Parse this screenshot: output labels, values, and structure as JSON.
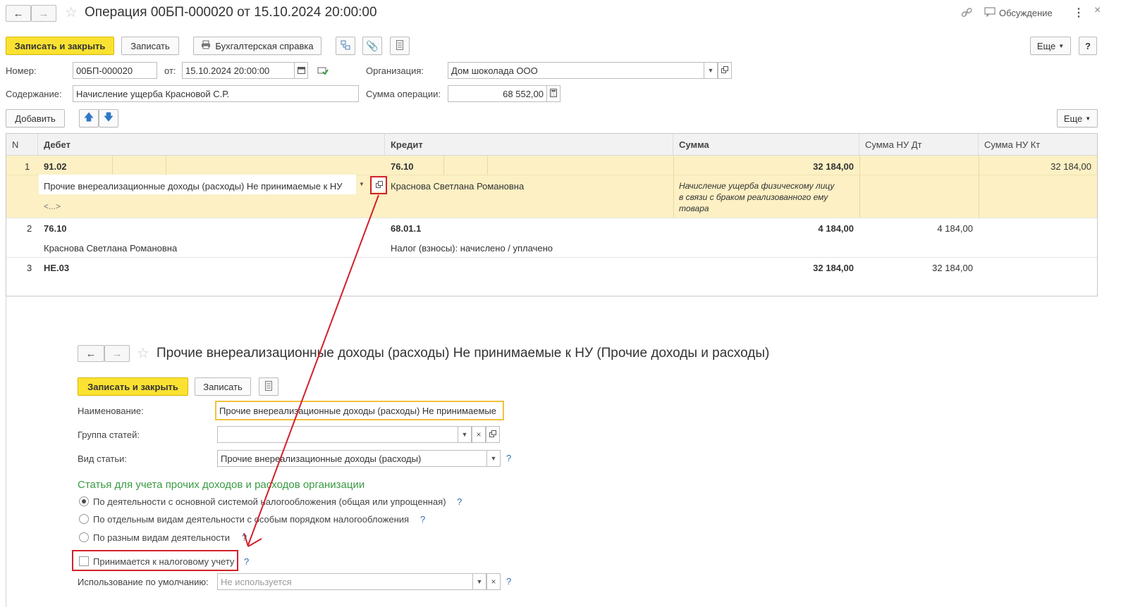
{
  "window": {
    "title": "Операция 00БП-000020 от 15.10.2024 20:00:00",
    "discussion_label": "Обсуждение",
    "more_menu_icon": "vertical-dots-icon"
  },
  "toolbar": {
    "save_close_label": "Записать и закрыть",
    "save_label": "Записать",
    "accounting_note_label": "Бухгалтерская справка",
    "more_label": "Еще",
    "help_label": "?"
  },
  "header": {
    "number_label": "Номер:",
    "number_value": "00БП-000020",
    "date_label": "от:",
    "date_value": "15.10.2024 20:00:00",
    "org_label": "Организация:",
    "org_value": "Дом шоколада ООО",
    "content_label": "Содержание:",
    "content_value": "Начисление ущерба Красновой С.Р.",
    "sum_label": "Сумма операции:",
    "sum_value": "68 552,00"
  },
  "table_toolbar": {
    "add_label": "Добавить",
    "more_label": "Еще"
  },
  "table": {
    "columns": [
      "N",
      "Дебет",
      "Кредит",
      "Сумма",
      "Сумма НУ Дт",
      "Сумма НУ Кт"
    ],
    "rows": [
      {
        "n": "1",
        "debit": "91.02",
        "debit_sub1": "Прочие внереализационные доходы (расходы) Не принимаемые к НУ",
        "debit_sub2": "<...>",
        "credit": "76.10",
        "credit_sub1": "Краснова Светлана Романовна",
        "sum": "32 184,00",
        "sum_comment_1": "Начисление ущерба физическому лицу",
        "sum_comment_2": "в связи с браком реализованного ему",
        "sum_comment_3": "товара",
        "nu_dt": "",
        "nu_kt": "32 184,00"
      },
      {
        "n": "2",
        "debit": "76.10",
        "debit_sub1": "Краснова Светлана Романовна",
        "credit": "68.01.1",
        "credit_sub1": "Налог (взносы): начислено / уплачено",
        "sum": "4 184,00",
        "nu_dt": "4 184,00",
        "nu_kt": ""
      },
      {
        "n": "3",
        "debit": "НЕ.03",
        "credit": "",
        "sum": "32 184,00",
        "nu_dt": "32 184,00",
        "nu_kt": ""
      }
    ]
  },
  "sub_form": {
    "title": "Прочие внереализационные доходы (расходы) Не принимаемые к НУ (Прочие доходы и расходы)",
    "save_close_label": "Записать и закрыть",
    "save_label": "Записать",
    "name_label": "Наименование:",
    "name_value": "Прочие внереализационные доходы (расходы) Не принимаемые",
    "group_label": "Группа статей:",
    "group_value": "",
    "kind_label": "Вид статьи:",
    "kind_value": "Прочие внереализационные доходы (расходы)",
    "section_title": "Статья для учета прочих доходов и расходов организации",
    "radio_options": [
      "По деятельности с основной системой налогообложения (общая или упрощенная)",
      "По отдельным видам деятельности с особым порядком налогообложения",
      "По разным видам деятельности"
    ],
    "radio_selected_index": 0,
    "tax_checkbox_label": "Принимается к налоговому учету",
    "tax_checkbox_checked": false,
    "usage_label": "Использование по умолчанию:",
    "usage_placeholder": "Не используется",
    "help_mark": "?"
  },
  "colors": {
    "primary_button": "#fbe232",
    "row_highlight": "#fcf0c4",
    "section_title": "#3a9a43",
    "annotation_red": "#d3202b",
    "help_blue": "#2a6fb0"
  }
}
